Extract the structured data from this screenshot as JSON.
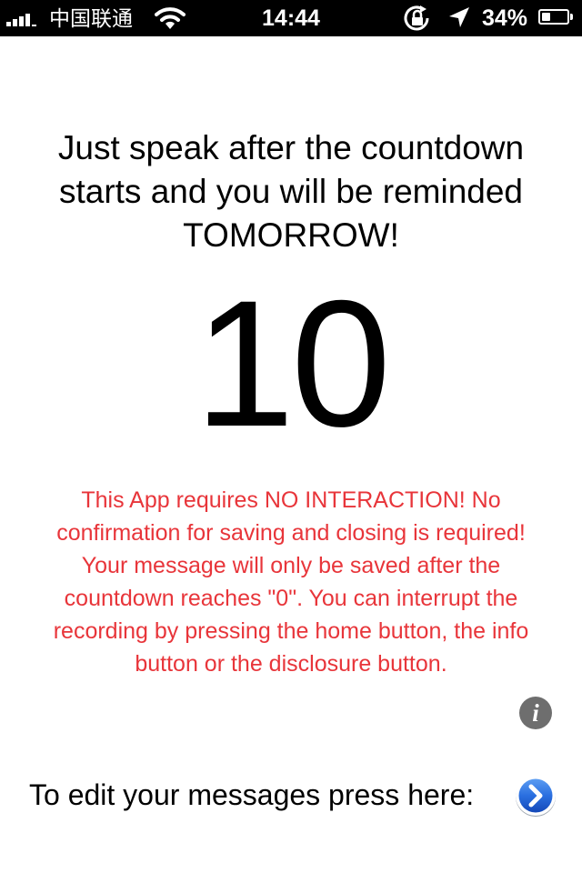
{
  "status_bar": {
    "carrier": "中国联通",
    "time": "14:44",
    "battery_percent": "34%",
    "battery_level": 0.34,
    "signal_bars": 4,
    "icons": [
      "signal-icon",
      "wifi-icon",
      "rotation-lock-icon",
      "location-icon",
      "battery-icon"
    ]
  },
  "main": {
    "headline": "Just speak after the countdown starts and you will be reminded TOMORROW!",
    "countdown": "10",
    "warning": "This App requires  NO INTERACTION!  No confirmation for saving and closing  is required! Your message will only be saved after the countdown reaches \"0\". You can interrupt the recording by pressing the home button, the info button or the disclosure button.",
    "info_icon": "i",
    "edit_prompt": "To edit your messages press here:"
  },
  "colors": {
    "warning_text": "#e8353a",
    "disclosure_blue": "#1f63d6",
    "info_gray": "#6e6e6e"
  }
}
